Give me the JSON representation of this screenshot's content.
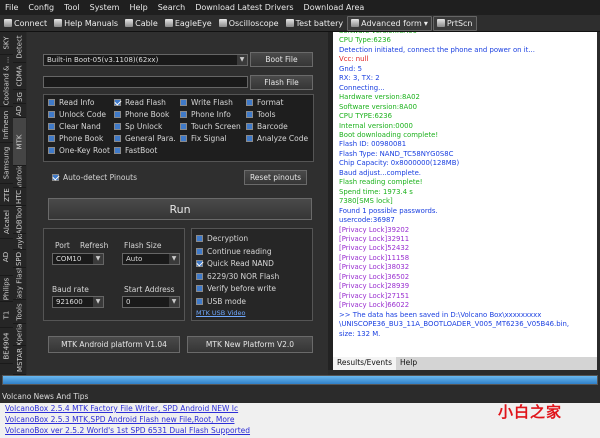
{
  "menu": [
    "File",
    "Config",
    "Tool",
    "System",
    "Help",
    "Search",
    "Download Latest Drivers",
    "Download Area"
  ],
  "toolbar": [
    {
      "label": "Connect",
      "icon": "connect-icon"
    },
    {
      "label": "Help Manuals",
      "icon": "book-icon"
    },
    {
      "label": "Cable",
      "icon": "cable-icon"
    },
    {
      "label": "EagleEye",
      "icon": "eye-icon"
    },
    {
      "label": "Oscilloscope",
      "icon": "oscilloscope-icon"
    },
    {
      "label": "Test battery",
      "icon": "battery-icon"
    },
    {
      "label": "Advanced form",
      "icon": "gear-icon"
    },
    {
      "label": "PrtScn",
      "icon": "camera-icon"
    }
  ],
  "left_tabs_a": [
    "Detect",
    "SKY",
    "CDMA",
    "Coolsand & ...",
    "3G",
    "AD",
    "Infineon",
    "MTK",
    "Samsung",
    "Android",
    "HTC",
    "ZTE",
    "ADBTool",
    "Alcatel",
    "Anyka",
    "SPD",
    "AD",
    "Easy Flash",
    "Philips",
    "Tools",
    "T1",
    "Xperia",
    "MSTAR",
    "BE4904"
  ],
  "main": {
    "boot_select": "Built-in Boot-05(v3.1108)(62xx)",
    "boot_file_label": "Boot File",
    "flash_file_label": "Flash File",
    "options": [
      {
        "label": "Read Info",
        "checked": false
      },
      {
        "label": "Read Flash",
        "checked": true
      },
      {
        "label": "Write Flash",
        "checked": false
      },
      {
        "label": "Format",
        "checked": false
      },
      {
        "label": "Unlock Code",
        "checked": false
      },
      {
        "label": "Phone Book",
        "checked": false
      },
      {
        "label": "Phone Info",
        "checked": false
      },
      {
        "label": "Tools",
        "checked": false
      },
      {
        "label": "Clear Nand",
        "checked": false
      },
      {
        "label": "Sp Unlock",
        "checked": false
      },
      {
        "label": "Touch Screen",
        "checked": false
      },
      {
        "label": "Barcode",
        "checked": false
      },
      {
        "label": "Phone Book",
        "checked": false
      },
      {
        "label": "General Para.",
        "checked": false
      },
      {
        "label": "Fix Signal",
        "checked": false
      },
      {
        "label": "Analyze Code",
        "checked": false
      },
      {
        "label": "One-Key Root",
        "checked": false
      },
      {
        "label": "FastBoot",
        "checked": false
      }
    ],
    "auto_detect_label": "Auto-detect Pinouts",
    "reset_pinouts_label": "Reset pinouts",
    "run_label": "Run",
    "port_label": "Port",
    "refresh_label": "Refresh",
    "port_value": "COM10",
    "flash_size_label": "Flash Size",
    "flash_size_value": "Auto",
    "baud_label": "Baud rate",
    "baud_value": "921600",
    "start_address_label": "Start Address",
    "start_address_value": "0",
    "right_options": [
      {
        "label": "Decryption",
        "checked": false
      },
      {
        "label": "Continue reading",
        "checked": false
      },
      {
        "label": "Quick Read NAND",
        "checked": true
      },
      {
        "label": "6229/30 NOR Flash",
        "checked": false
      },
      {
        "label": "Verify before write",
        "checked": false
      },
      {
        "label": "USB mode",
        "checked": false
      }
    ],
    "usb_video_link": "MTK USB Video",
    "mtk_android_label": "MTK Android platform V1.04",
    "mtk_new_label": "MTK New Platform V2.0"
  },
  "log": [
    {
      "text": "Software version:8A00",
      "color": "g"
    },
    {
      "text": "CPU Type:6236",
      "color": "g"
    },
    {
      "text": "Detection initiated, connect the phone and power on it...",
      "color": "b"
    },
    {
      "text": "Vcc: null",
      "color": "r"
    },
    {
      "text": "Gnd: 5",
      "color": "b"
    },
    {
      "text": "RX: 3, TX: 2",
      "color": "b"
    },
    {
      "text": "",
      "color": "b"
    },
    {
      "text": "Connecting...",
      "color": "b"
    },
    {
      "text": "Hardware version:8A02",
      "color": "g"
    },
    {
      "text": "Software version:8A00",
      "color": "g"
    },
    {
      "text": "CPU TYPE:6236",
      "color": "g"
    },
    {
      "text": "Internal version:0000",
      "color": "g"
    },
    {
      "text": "Boot downloading complete!",
      "color": "g"
    },
    {
      "text": "Flash ID: 00980081",
      "color": "b"
    },
    {
      "text": "Flash Type: NAND_TC58NYG0S8C",
      "color": "b"
    },
    {
      "text": "Chip Capacity: 0x8000000(128MB)",
      "color": "b"
    },
    {
      "text": "Baud adjust...complete.",
      "color": "b"
    },
    {
      "text": "Flash reading complete!",
      "color": "g"
    },
    {
      "text": "Spend time: 1973.4 s",
      "color": "g"
    },
    {
      "text": "7380[SMS lock]",
      "color": "g"
    },
    {
      "text": "Found 1 possible passwords.",
      "color": "b"
    },
    {
      "text": "usercode:36987",
      "color": "b"
    },
    {
      "text": "[Privacy Lock]39202",
      "color": "m"
    },
    {
      "text": "[Privacy Lock]32911",
      "color": "m"
    },
    {
      "text": "[Privacy Lock]52432",
      "color": "m"
    },
    {
      "text": "[Privacy Lock]11158",
      "color": "m"
    },
    {
      "text": "[Privacy Lock]38032",
      "color": "m"
    },
    {
      "text": "[Privacy Lock]36502",
      "color": "m"
    },
    {
      "text": "[Privacy Lock]28939",
      "color": "m"
    },
    {
      "text": "[Privacy Lock]27151",
      "color": "m"
    },
    {
      "text": "[Privacy Lock]66022",
      "color": "m"
    },
    {
      "text": ">> The data has been saved in D:\\Volcano Box\\xxxxxxxxx",
      "color": "b"
    },
    {
      "text": "\\UNISCOPE36_BU3_11A_BOOTLOADER_V005_MT6236_V05B46.bin,",
      "color": "b"
    },
    {
      "text": "size: 132 M.",
      "color": "b"
    }
  ],
  "log_tabs": [
    "Results/Events",
    "Help"
  ],
  "progress": 1.0,
  "news": {
    "title": "Volcano News And Tips",
    "items": [
      "VolcanoBox 2.5.4 MTK Factory File Writer, SPD Android NEW Ic",
      "VolcanoBox 2.5.3 MTK,SPD Android Flash new File,Root, More",
      "VolcanoBox ver 2.5.2 World's 1st SPD 6531 Dual Flash Supported"
    ]
  },
  "watermark": "小白之家"
}
